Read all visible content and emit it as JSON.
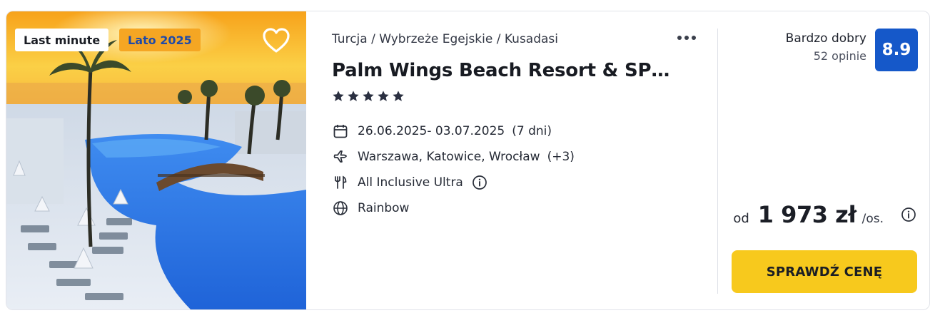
{
  "offer": {
    "badges": {
      "last_minute": "Last minute",
      "season": "Lato 2025"
    },
    "breadcrumb": "Turcja / Wybrzeże Egejskie / Kusadasi",
    "title": "Palm Wings Beach Resort & SP…",
    "stars": 5,
    "dates": "26.06.2025- 03.07.2025",
    "duration": "(7 dni)",
    "departure": "Warszawa, Katowice, Wrocław",
    "departure_extra": "(+3)",
    "board": "All Inclusive Ultra",
    "operator": "Rainbow",
    "rating": {
      "label": "Bardzo dobry",
      "count": "52 opinie",
      "score": "8.9"
    },
    "price": {
      "prefix": "od",
      "amount": "1 973 zł",
      "suffix": "/os."
    },
    "cta_label": "SPRAWDŹ CENĘ"
  },
  "icons": {
    "favorite": "heart-icon",
    "more": "more-dots-icon",
    "calendar": "calendar-icon",
    "flight": "plane-icon",
    "board": "cutlery-icon",
    "operator": "globe-icon",
    "info": "info-icon"
  },
  "colors": {
    "accent_cta": "#f7c91d",
    "score_bg": "#1558c9",
    "season_badge_bg": "#f5a623",
    "season_badge_text": "#1f4aa8"
  }
}
